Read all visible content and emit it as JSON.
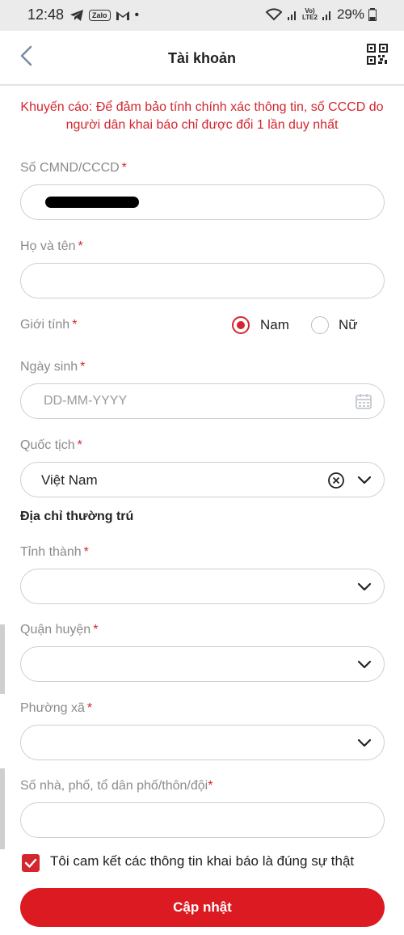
{
  "status_bar": {
    "time": "12:48",
    "zalo": "Zalo",
    "dot": "•",
    "vo_lte": "Vo)",
    "lte": "LTE2",
    "battery": "29%"
  },
  "header": {
    "title": "Tài khoản"
  },
  "warning": "Khuyến cáo: Để đảm bảo tính chính xác thông tin, số CCCD do người dân khai báo chỉ được đổi 1 lần duy nhất",
  "form": {
    "id_number": {
      "label": "Số CMND/CCCD",
      "required": "*",
      "value": ""
    },
    "full_name": {
      "label": "Họ và tên",
      "required": "*",
      "value": ""
    },
    "gender": {
      "label": "Giới tính",
      "required": "*",
      "options": [
        "Nam",
        "Nữ"
      ],
      "selected": "Nam"
    },
    "birth_date": {
      "label": "Ngày sinh",
      "required": "*",
      "placeholder": "DD-MM-YYYY"
    },
    "nationality": {
      "label": "Quốc tịch",
      "required": "*",
      "value": "Việt Nam"
    },
    "address_section": "Địa chỉ thường trú",
    "province": {
      "label": "Tỉnh thành",
      "required": "*"
    },
    "district": {
      "label": "Quận huyện",
      "required": "*"
    },
    "ward": {
      "label": "Phường xã",
      "required": "*"
    },
    "street": {
      "label": "Số nhà, phố, tổ dân phố/thôn/đội",
      "required": "*"
    },
    "commit": {
      "label": "Tôi cam kết các thông tin khai báo là đúng sự thật",
      "checked": true
    },
    "submit": "Cập nhật"
  },
  "colors": {
    "accent": "#dc1a21",
    "warning_text": "#d4262f"
  }
}
